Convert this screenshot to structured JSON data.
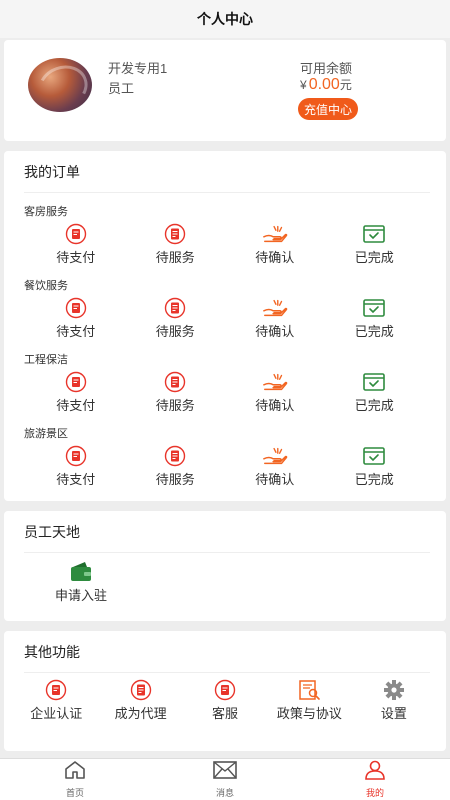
{
  "header": {
    "title": "个人中心"
  },
  "profile": {
    "name": "开发专用1",
    "role": "员工",
    "balance_label": "可用余额",
    "currency": "¥",
    "balance": "0.00",
    "unit": "元",
    "recharge_label": "充值中心"
  },
  "orders": {
    "title": "我的订单",
    "groups": [
      {
        "name": "客房服务",
        "items": [
          "待支付",
          "待服务",
          "待确认",
          "已完成"
        ]
      },
      {
        "name": "餐饮服务",
        "items": [
          "待支付",
          "待服务",
          "待确认",
          "已完成"
        ]
      },
      {
        "name": "工程保洁",
        "items": [
          "待支付",
          "待服务",
          "待确认",
          "已完成"
        ]
      },
      {
        "name": "旅游景区",
        "items": [
          "待支付",
          "待服务",
          "待确认",
          "已完成"
        ]
      }
    ]
  },
  "staff": {
    "title": "员工天地",
    "apply_label": "申请入驻"
  },
  "other": {
    "title": "其他功能",
    "items": [
      "企业认证",
      "成为代理",
      "客服",
      "政策与协议",
      "设置"
    ]
  },
  "tabbar": {
    "items": [
      "首页",
      "消息",
      "我的"
    ]
  },
  "colors": {
    "accent": "#f05a1a",
    "icon_red": "#e8342a",
    "icon_green": "#2e8b3e",
    "icon_orange": "#f26522",
    "active_tab": "#e8342a"
  }
}
